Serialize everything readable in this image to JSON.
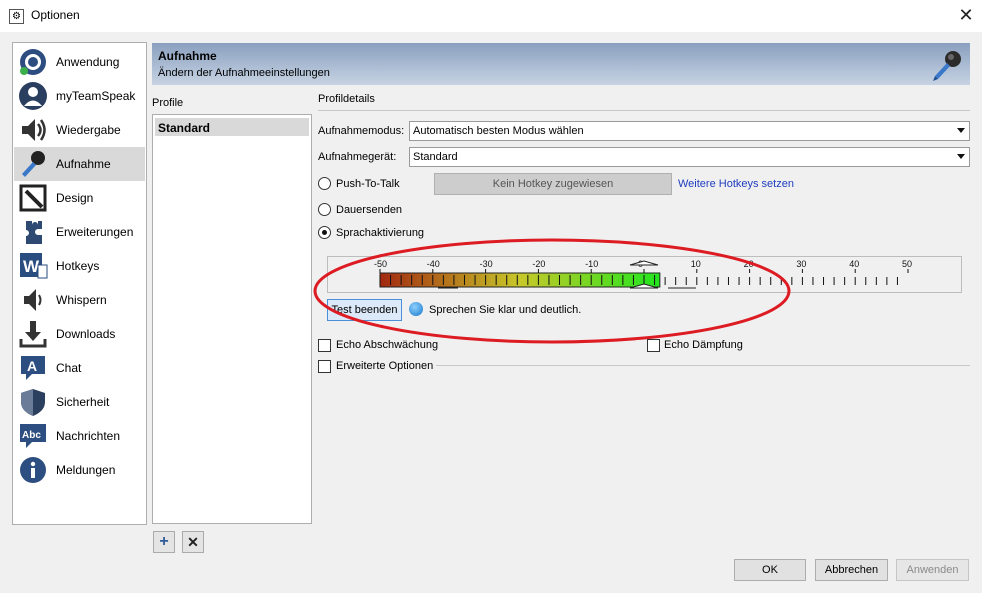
{
  "window": {
    "title": "Optionen",
    "close_glyph": "✕"
  },
  "sidebar": {
    "items": [
      {
        "label": "Anwendung",
        "icon": "teamspeak-logo-icon"
      },
      {
        "label": "myTeamSpeak",
        "icon": "user-profile-icon"
      },
      {
        "label": "Wiedergabe",
        "icon": "speaker-icon"
      },
      {
        "label": "Aufnahme",
        "icon": "microphone-icon"
      },
      {
        "label": "Design",
        "icon": "design-pen-icon"
      },
      {
        "label": "Erweiterungen",
        "icon": "puzzle-icon"
      },
      {
        "label": "Hotkeys",
        "icon": "w-keyboard-icon"
      },
      {
        "label": "Whispern",
        "icon": "whisper-speaker-icon"
      },
      {
        "label": "Downloads",
        "icon": "download-icon"
      },
      {
        "label": "Chat",
        "icon": "chat-bubble-icon"
      },
      {
        "label": "Sicherheit",
        "icon": "shield-icon"
      },
      {
        "label": "Nachrichten",
        "icon": "abc-message-icon"
      },
      {
        "label": "Meldungen",
        "icon": "info-icon"
      }
    ],
    "active_index": 3
  },
  "header": {
    "title": "Aufnahme",
    "subtitle": "Ändern der Aufnahmeeinstellungen",
    "icon": "microphone-icon"
  },
  "profiles": {
    "label": "Profile",
    "items": [
      "Standard"
    ],
    "add_glyph": "+",
    "remove_glyph": "✕"
  },
  "details": {
    "label": "Profildetails",
    "mode_label": "Aufnahmemodus:",
    "mode_value": "Automatisch besten Modus wählen",
    "device_label": "Aufnahmegerät:",
    "device_value": "Standard",
    "ptt_label": "Push-To-Talk",
    "hotkey_button": "Kein Hotkey zugewiesen",
    "more_hotkeys": "Weitere Hotkeys setzen",
    "continuous_label": "Dauersenden",
    "voice_activation_label": "Sprachaktivierung",
    "selected_mode": "Sprachaktivierung",
    "meter": {
      "ticks": [
        "-50",
        "-40",
        "-30",
        "-20",
        "-10",
        "0",
        "10",
        "20",
        "30",
        "40",
        "50"
      ],
      "level_fraction": 0.26,
      "threshold_db": 0,
      "colors": {
        "low": "#a22810",
        "mid": "#c8c82a",
        "high": "#22e61e"
      }
    },
    "test_button": "Test beenden",
    "speak_hint": "Sprechen Sie klar und deutlich.",
    "echo_reduction_label": "Echo Abschwächung",
    "echo_cancel_label": "Echo Dämpfung",
    "advanced_label": "Erweiterte Optionen",
    "annotation_color": "#dd1b22"
  },
  "buttons": {
    "ok": "OK",
    "cancel": "Abbrechen",
    "apply": "Anwenden"
  }
}
